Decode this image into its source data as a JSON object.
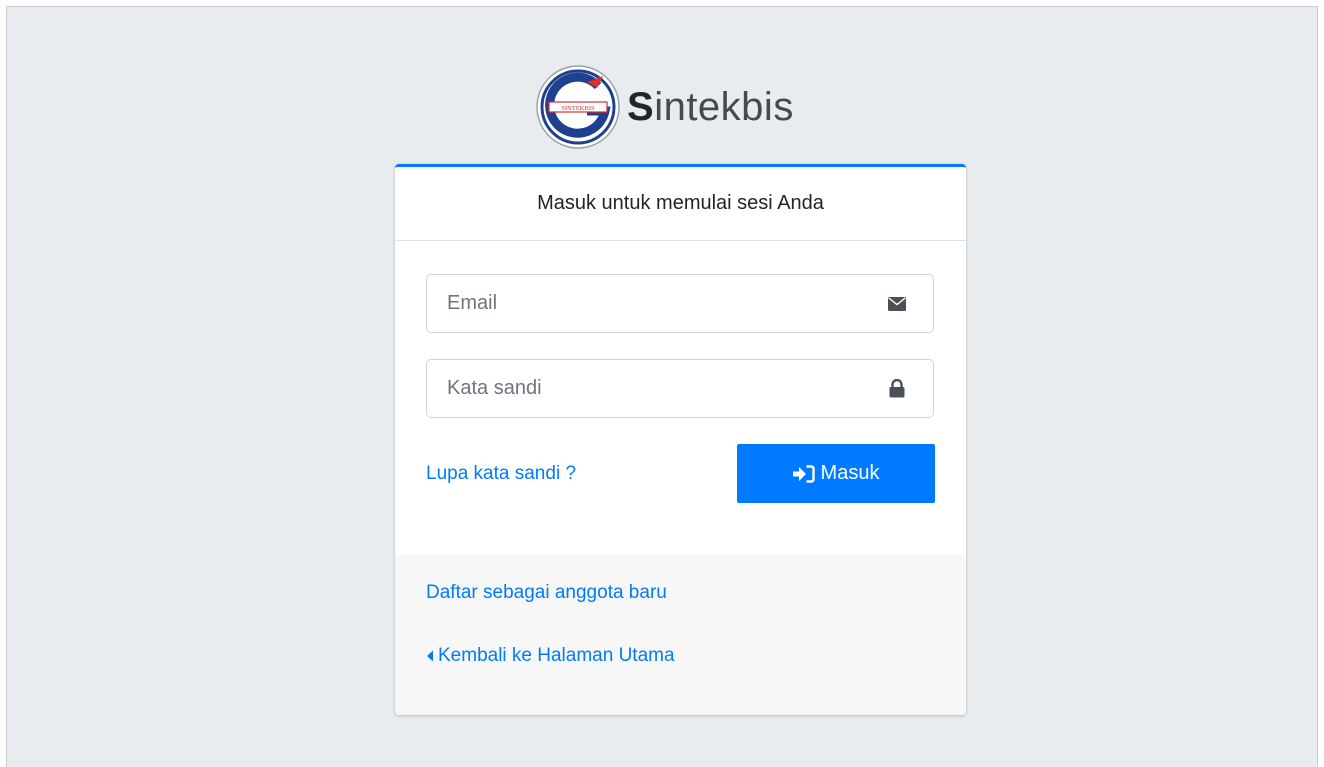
{
  "brand": {
    "first_letter": "S",
    "rest": "intekbis",
    "logo_text": "SINTEKBIS",
    "colors": {
      "logo_blue": "#1f3f8f",
      "logo_red": "#d9302c"
    }
  },
  "login_card": {
    "header_text": "Masuk untuk memulai sesi Anda",
    "email": {
      "placeholder": "Email",
      "value": "",
      "icon": "envelope-icon"
    },
    "password": {
      "placeholder": "Kata sandi",
      "value": "",
      "icon": "lock-icon"
    },
    "forgot_link": "Lupa kata sandi ?",
    "submit_label": "Masuk",
    "submit_icon": "sign-in-icon",
    "accent_color": "#007bff"
  },
  "footer": {
    "register_link": "Daftar sebagai anggota baru",
    "back_link": "Kembali ke Halaman Utama",
    "back_icon": "caret-left-icon"
  }
}
